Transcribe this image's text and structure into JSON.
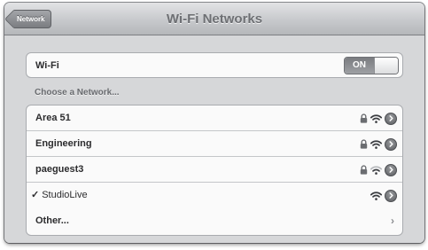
{
  "nav": {
    "back_label": "Network",
    "title": "Wi-Fi Networks"
  },
  "wifi": {
    "label": "Wi-Fi",
    "toggle_label": "ON"
  },
  "section_header": "Choose a Network...",
  "networks": [
    {
      "name": "Area 51",
      "secured": true,
      "signal": 3,
      "selected": false
    },
    {
      "name": "Engineering",
      "secured": true,
      "signal": 3,
      "selected": false
    },
    {
      "name": "paeguest3",
      "secured": true,
      "signal": 2,
      "selected": false
    },
    {
      "name": "StudioLive",
      "secured": false,
      "signal": 3,
      "selected": true,
      "check": "✓"
    }
  ],
  "other": {
    "label": "Other...",
    "chevron": "›"
  },
  "icons": {
    "lock": "lock-icon",
    "wifi": "wifi-signal-icon",
    "detail": "detail-disclosure-icon",
    "chevron": "chevron-right-icon",
    "back": "back-arrow-icon"
  },
  "colors": {
    "navbar_top": "#e2e3e5",
    "navbar_bottom": "#b5b7ba",
    "background": "#d6d7d9",
    "cell": "#fafafa",
    "toggle_on": "#8a8c90"
  }
}
